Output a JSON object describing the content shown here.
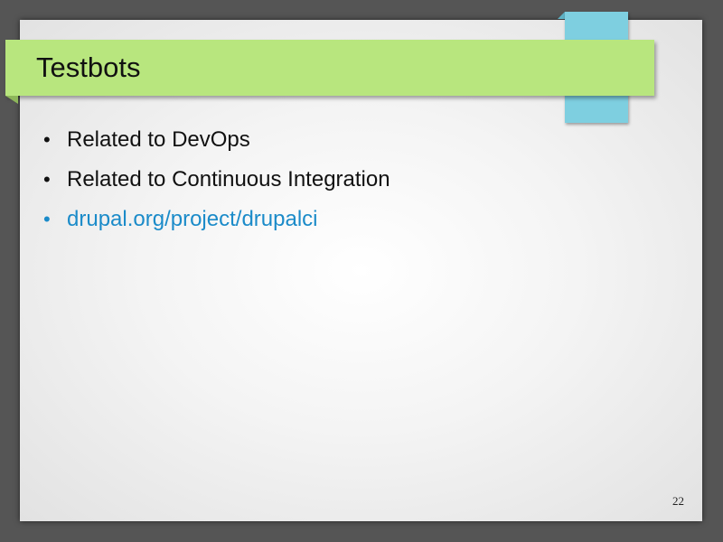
{
  "slide": {
    "title": "Testbots",
    "bullets": [
      {
        "text": "Related to DevOps",
        "type": "text"
      },
      {
        "text": "Related to Continuous Integration",
        "type": "text"
      },
      {
        "text": "drupal.org/project/drupalci",
        "type": "link"
      }
    ],
    "bullet_symbol": "•",
    "page_number": "22"
  },
  "colors": {
    "title_bar": "#b8e67e",
    "accent_tab": "#7ecfe0",
    "link": "#1b8bc9"
  }
}
